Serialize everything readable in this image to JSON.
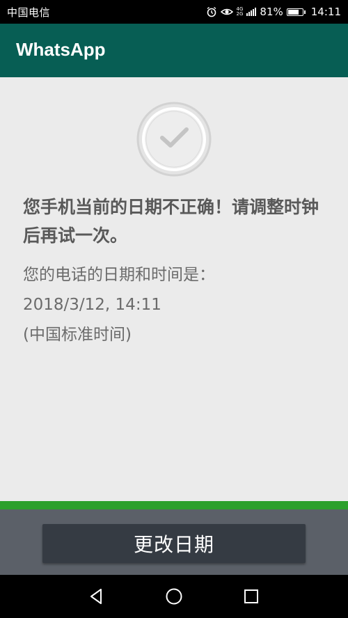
{
  "status_bar": {
    "carrier": "中国电信",
    "network_top": "4G",
    "network_bottom": "2G",
    "battery": "81%",
    "battery_level": 0.81,
    "time": "14:11",
    "icons": [
      "alarm-icon",
      "eye-icon",
      "signal-icon",
      "battery-icon"
    ]
  },
  "app_bar": {
    "title": "WhatsApp"
  },
  "content": {
    "icon": "checkmark-circle-icon",
    "heading": "您手机当前的日期不正确！请调整时钟后再试一次。",
    "info_line1": "您的电话的日期和时间是：",
    "info_line2": "2018/3/12, 14:11",
    "info_line3": "(中国标准时间)"
  },
  "action": {
    "change_date_label": "更改日期"
  },
  "nav": {
    "icons": [
      "back-icon",
      "home-icon",
      "recents-icon"
    ]
  },
  "colors": {
    "app_bar": "#075e54",
    "accent_line": "#2ca02c",
    "button": "#353b43",
    "panel": "#5b6068",
    "background": "#ebebeb"
  }
}
